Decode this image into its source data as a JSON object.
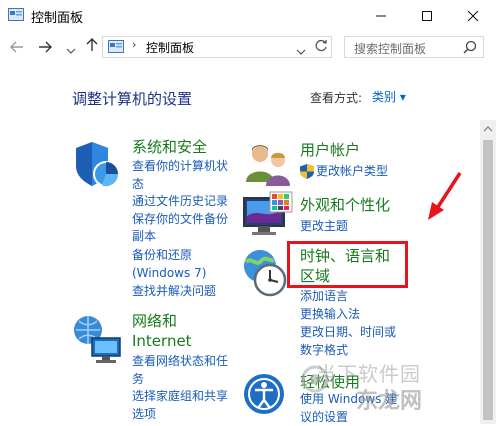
{
  "window": {
    "title": "控制面板",
    "minimize_icon": "minimize-icon",
    "maximize_icon": "maximize-icon",
    "close_icon": "close-icon"
  },
  "nav": {
    "back_icon": "arrow-left-icon",
    "forward_icon": "arrow-right-icon",
    "history_icon": "chevron-down-icon",
    "up_icon": "arrow-up-icon",
    "address_separator": "›",
    "address_text": "控制面板",
    "search_placeholder": "搜索控制面板"
  },
  "main": {
    "heading": "调整计算机的设置",
    "view_by_label": "查看方式:",
    "view_by_value": "类别 ▾"
  },
  "categories_left": [
    {
      "title": "系统和安全",
      "icon": "shield-icon",
      "links": [
        "查看你的计算机状态",
        "通过文件历史记录保存你的文件备份副本",
        "备份和还原(Windows 7)",
        "查找并解决问题"
      ]
    },
    {
      "title": "网络和 Internet",
      "icon": "network-icon",
      "links": [
        "查看网络状态和任务",
        "选择家庭组和共享选项"
      ]
    }
  ],
  "categories_right": [
    {
      "title": "用户帐户",
      "icon": "users-icon",
      "links": [
        "更改帐户类型"
      ]
    },
    {
      "title": "外观和个性化",
      "icon": "monitor-icon",
      "links": [
        "更改主题"
      ]
    },
    {
      "title": "时钟、语言和区域",
      "icon": "clock-globe-icon",
      "links": [
        "添加语言",
        "更换输入法",
        "更改日期、时间或数字格式"
      ]
    },
    {
      "title": "轻松使用",
      "icon": "ease-of-access-icon",
      "links": [
        "使用 Windows 建议的设置"
      ]
    }
  ],
  "watermark": {
    "line1": "当下软件园",
    "line2": "东龙网"
  },
  "colors": {
    "category_title": "#187a1d",
    "link": "#1a5bb8",
    "heading": "#1e3287",
    "highlight_box": "#e8141b",
    "arrow": "#e8141b"
  }
}
